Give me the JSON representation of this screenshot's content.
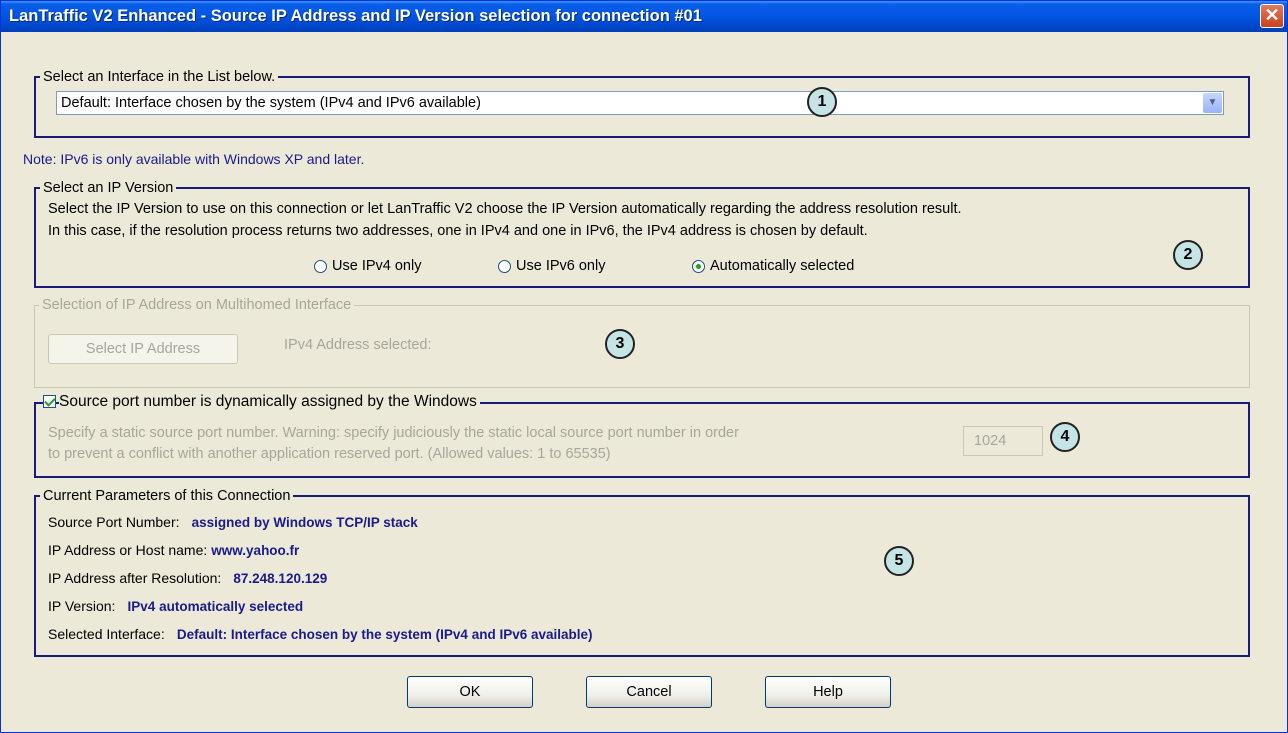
{
  "window": {
    "title": "LanTraffic V2 Enhanced - Source IP Address and IP Version selection for connection #01",
    "close_glyph": "✕"
  },
  "interface_group": {
    "legend": "Select an Interface in the List below.",
    "selected_value": "Default: Interface chosen by the system (IPv4 and IPv6 available)",
    "arrow_glyph": "▼",
    "badge": "1"
  },
  "note": "Note: IPv6 is only available with Windows XP and later.",
  "ip_version_group": {
    "legend": "Select an IP Version",
    "line1": "Select the IP Version to use on this connection or let LanTraffic V2 choose the IP Version automatically regarding the address resolution result.",
    "line2": "In this case, if the resolution process returns two addresses, one in IPv4 and one in IPv6,  the IPv4 address is chosen by default.",
    "options": [
      {
        "label": "Use IPv4 only",
        "selected": false
      },
      {
        "label": "Use IPv6 only",
        "selected": false
      },
      {
        "label": "Automatically selected",
        "selected": true
      }
    ],
    "badge": "2"
  },
  "multihomed_group": {
    "legend": "Selection of IP Address on Multihomed Interface",
    "button_label": "Select IP Address",
    "selected_label": "IPv4 Address selected:",
    "badge": "3"
  },
  "port_group": {
    "checkbox_label": "Source port number is dynamically assigned by  the Windows",
    "checked": true,
    "line1": "Specify a static source port number.  Warning: specify judiciously the static local source port number in order",
    "line2": "to prevent a conflict with another application reserved port. (Allowed values: 1 to 65535)",
    "port_value": "1024",
    "badge": "4"
  },
  "params_group": {
    "legend": "Current Parameters of this Connection",
    "rows": [
      {
        "label": "Source Port Number:",
        "value": "assigned by Windows TCP/IP stack"
      },
      {
        "label": "IP Address or Host name:",
        "value": "www.yahoo.fr"
      },
      {
        "label": "IP Address after Resolution:",
        "value": "87.248.120.129"
      },
      {
        "label": "IP Version:",
        "value": "IPv4 automatically selected"
      },
      {
        "label": "Selected Interface:",
        "value": "Default: Interface chosen by the system (IPv4 and IPv6 available)"
      }
    ],
    "badge": "5"
  },
  "buttons": {
    "ok": "OK",
    "cancel": "Cancel",
    "help": "Help"
  }
}
